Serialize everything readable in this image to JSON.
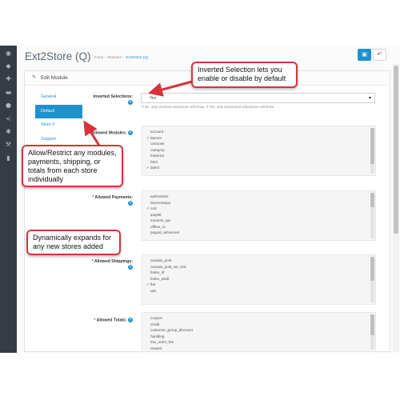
{
  "header": {
    "title": "Ext2Store (Q)",
    "breadcrumb": [
      "Home",
      "Modules",
      "Ext2Store (Q)"
    ],
    "save_icon": "save-icon",
    "back_icon": "reply-icon"
  },
  "sidebar": {
    "icons": [
      "dashboard-icon",
      "tag-icon",
      "puzzle-icon",
      "cart-icon",
      "user-icon",
      "share-icon",
      "gear-icon",
      "wrench-icon",
      "bar-chart-icon"
    ]
  },
  "panel": {
    "title": "Edit Module",
    "icon": "pencil-icon"
  },
  "tabs": [
    {
      "label": "General",
      "active": false
    },
    {
      "label": "Default",
      "active": true
    },
    {
      "label": "Store 2",
      "active": false
    },
    {
      "label": "Support",
      "active": false
    }
  ],
  "inverted": {
    "label": "Inverted Selections:",
    "value": "Yes",
    "help": "If No, only checked extensions will show. If Yes, only unchecked extensions will show"
  },
  "modules": {
    "label": "Allowed Modules:",
    "items": [
      {
        "name": "account",
        "checked": false
      },
      {
        "name": "banner",
        "checked": true
      },
      {
        "name": "carousel",
        "checked": false
      },
      {
        "name": "category",
        "checked": false
      },
      {
        "name": "featured",
        "checked": false
      },
      {
        "name": "html",
        "checked": false
      },
      {
        "name": "latest",
        "checked": true
      }
    ]
  },
  "payments": {
    "label": "Allowed Payments:",
    "items": [
      {
        "name": "authnetsim",
        "checked": false
      },
      {
        "name": "bluenetaeps",
        "checked": false
      },
      {
        "name": "cod",
        "checked": true
      },
      {
        "name": "ipay88",
        "checked": false
      },
      {
        "name": "moneris_api",
        "checked": false
      },
      {
        "name": "offline_cc",
        "checked": false
      },
      {
        "name": "paypal_advanced",
        "checked": false
      }
    ]
  },
  "shippings": {
    "label": "Allowed Shippings:",
    "items": [
      {
        "name": "canada_post",
        "checked": false
      },
      {
        "name": "canada_post_ws_rest",
        "checked": false
      },
      {
        "name": "fedex_itl",
        "checked": false
      },
      {
        "name": "fedex_wsdl",
        "checked": false
      },
      {
        "name": "flat",
        "checked": true
      },
      {
        "name": "ups",
        "checked": false
      }
    ]
  },
  "totals": {
    "label": "Allowed Totals:",
    "items": [
      {
        "name": "coupon",
        "checked": false
      },
      {
        "name": "credit",
        "checked": false
      },
      {
        "name": "customer_group_discount",
        "checked": false
      },
      {
        "name": "handling",
        "checked": false
      },
      {
        "name": "low_order_fee",
        "checked": false
      },
      {
        "name": "reward",
        "checked": false
      }
    ]
  },
  "callouts": {
    "inverted": "Inverted Selection lets you enable or disable by default",
    "allow": "Allow/Restrict any modules, payments, shipping, or totals from each store individually",
    "expands": "Dynamically expands for any new stores added"
  },
  "colors": {
    "accent": "#1e91cf",
    "callout_border": "#d6333d",
    "sidebar": "#363b45"
  }
}
